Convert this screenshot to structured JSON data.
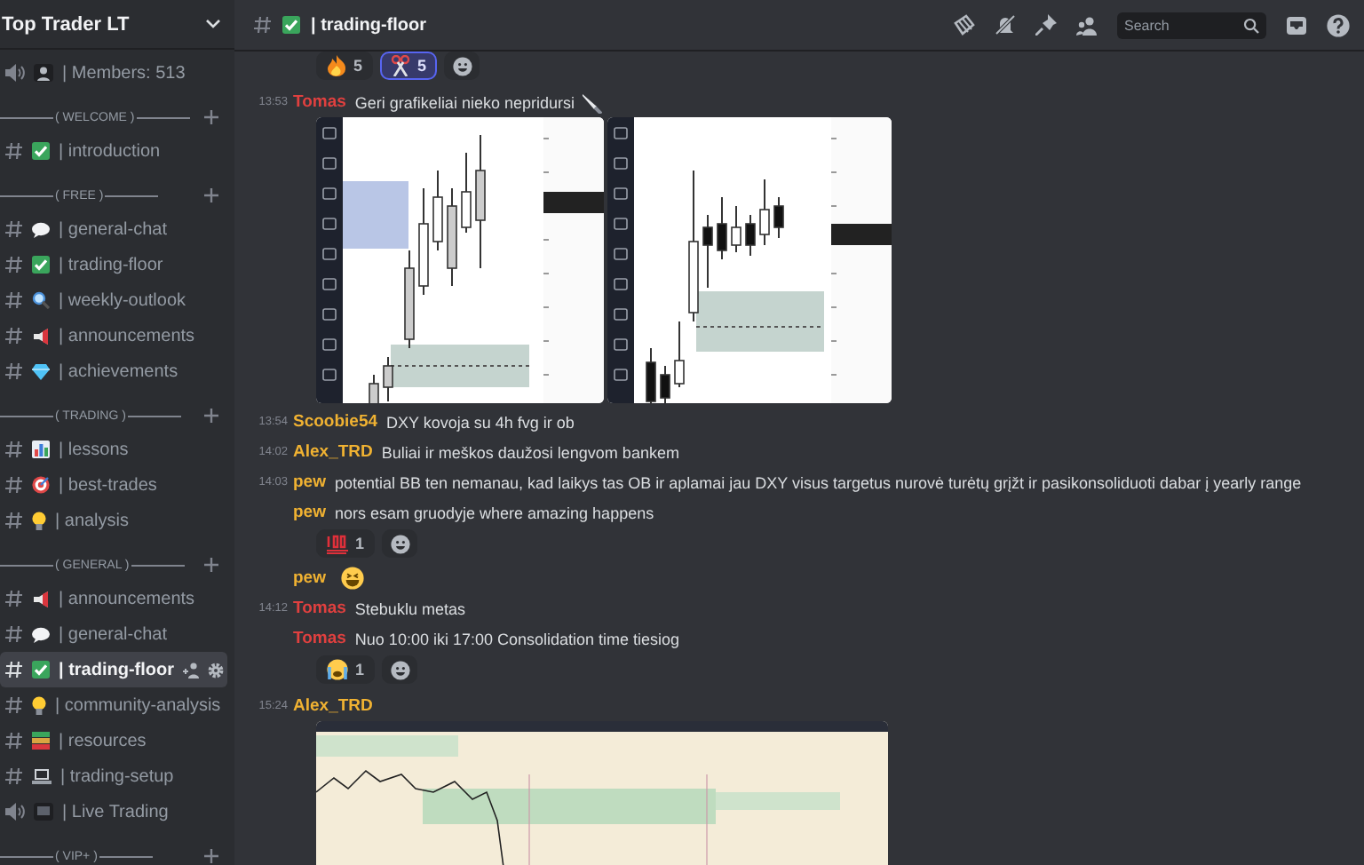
{
  "server": {
    "name": "Top Trader LT"
  },
  "sidebar": {
    "sections": [
      {
        "channels": [
          {
            "voice": true,
            "kind": "figure",
            "label": "| Members: 513",
            "selected": false
          }
        ]
      },
      {
        "category": "( WELCOME )",
        "channels": [
          {
            "voice": false,
            "kind": "check",
            "label": "| introduction",
            "selected": false
          }
        ]
      },
      {
        "category": "( FREE )",
        "channels": [
          {
            "voice": false,
            "kind": "bubble",
            "label": "| general-chat",
            "selected": false
          },
          {
            "voice": false,
            "kind": "check",
            "label": "| trading-floor",
            "selected": false
          },
          {
            "voice": false,
            "kind": "magnifier",
            "label": "| weekly-outlook",
            "selected": false
          },
          {
            "voice": false,
            "kind": "megaphone",
            "label": "| announcements",
            "selected": false
          },
          {
            "voice": false,
            "kind": "gem",
            "label": "| achievements",
            "selected": false
          }
        ]
      },
      {
        "category": "( TRADING )",
        "channels": [
          {
            "voice": false,
            "kind": "barchart",
            "label": "| lessons",
            "selected": false
          },
          {
            "voice": false,
            "kind": "target",
            "label": "| best-trades",
            "selected": false
          },
          {
            "voice": false,
            "kind": "bulb",
            "label": "| analysis",
            "selected": false
          }
        ]
      },
      {
        "category": "( GENERAL )",
        "channels": [
          {
            "voice": false,
            "kind": "megaphone",
            "label": "| announcements",
            "selected": false
          },
          {
            "voice": false,
            "kind": "bubble",
            "label": "| general-chat",
            "selected": false
          },
          {
            "voice": false,
            "kind": "check",
            "label": "| trading-floor",
            "selected": true
          },
          {
            "voice": false,
            "kind": "bulb",
            "label": "| community-analysis",
            "selected": false
          },
          {
            "voice": false,
            "kind": "books",
            "label": "| resources",
            "selected": false
          },
          {
            "voice": false,
            "kind": "laptop",
            "label": "| trading-setup",
            "selected": false
          },
          {
            "voice": true,
            "kind": "tv",
            "label": "| Live Trading",
            "selected": false
          }
        ]
      },
      {
        "category": "( VIP+ )"
      }
    ]
  },
  "header": {
    "kind": "check",
    "channel": "| trading-floor",
    "search": {
      "placeholder": "Search"
    }
  },
  "messages": [
    {
      "kind": "reactions",
      "items": [
        {
          "kind": "fire",
          "count": "5",
          "selected": false
        },
        {
          "kind": "scissors",
          "count": "5",
          "selected": true
        }
      ]
    },
    {
      "kind": "message",
      "time": "13:53",
      "author": "Tomas",
      "color": "#e0403f",
      "text": "Geri grafikeliai nieko nepridursi",
      "icons": [
        {
          "kind": "knife"
        }
      ]
    },
    {
      "kind": "attachments",
      "images": [
        {
          "kind": "candlestick"
        },
        {
          "kind": "candlestick"
        }
      ]
    },
    {
      "kind": "message",
      "time": "13:54",
      "author": "Scoobie54",
      "color": "#f0b232",
      "text": "DXY kovoja su 4h fvg ir ob"
    },
    {
      "kind": "message",
      "time": "14:02",
      "author": "Alex_TRD",
      "color": "#f0b232",
      "text": "Buliai ir meškos daužosi lengvom bankem"
    },
    {
      "kind": "message",
      "time": "14:03",
      "author": "pew",
      "color": "#f0b232",
      "text": "potential BB ten nemanau, kad laikys tas OB ir aplamai jau DXY visus targetus nurovė turėtų grįžt ir pasikonsoliduoti dabar į yearly range"
    },
    {
      "kind": "message",
      "author": "pew",
      "color": "#f0b232",
      "text": "nors esam gruodyje where amazing happens"
    },
    {
      "kind": "reactions",
      "items": [
        {
          "kind": "hundred",
          "count": "1",
          "selected": false
        }
      ]
    },
    {
      "kind": "message",
      "author": "pew",
      "color": "#f0b232",
      "icons": [
        {
          "kind": "grin"
        }
      ]
    },
    {
      "kind": "message",
      "time": "14:12",
      "author": "Tomas",
      "color": "#e0403f",
      "text": "Stebuklu metas"
    },
    {
      "kind": "message",
      "author": "Tomas",
      "color": "#e0403f",
      "text": "Nuo 10:00 iki 17:00 Consolidation time tiesiog"
    },
    {
      "kind": "reactions",
      "items": [
        {
          "kind": "crying",
          "count": "1",
          "selected": false
        }
      ]
    },
    {
      "kind": "message",
      "time": "15:24",
      "author": "Alex_TRD",
      "color": "#f0b232"
    },
    {
      "kind": "attachments",
      "images": [
        {
          "kind": "line"
        }
      ]
    }
  ]
}
